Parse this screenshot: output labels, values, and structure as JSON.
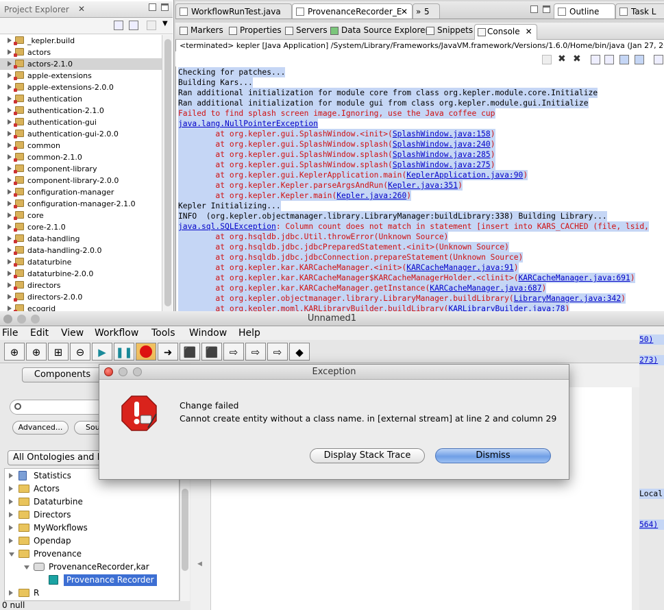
{
  "project_explorer": {
    "title": "Project Explorer",
    "items": [
      "_kepler.build",
      "actors",
      "actors-2.1.0",
      "apple-extensions",
      "apple-extensions-2.0.0",
      "authentication",
      "authentication-2.1.0",
      "authentication-gui",
      "authentication-gui-2.0.0",
      "common",
      "common-2.1.0",
      "component-library",
      "component-library-2.0.0",
      "configuration-manager",
      "configuration-manager-2.1.0",
      "core",
      "core-2.1.0",
      "data-handling",
      "data-handling-2.0.0",
      "dataturbine",
      "dataturbine-2.0.0",
      "directors",
      "directors-2.0.0",
      "ecogrid"
    ],
    "selected_index": 2
  },
  "editor_tabs": [
    "WorkflowRunTest.java",
    "ProvenanceRecorder_E",
    "5"
  ],
  "outline_tabs": [
    "Outline",
    "Task L"
  ],
  "console_tabs": [
    "Markers",
    "Properties",
    "Servers",
    "Data Source Explorer",
    "Snippets",
    "Console"
  ],
  "console_status": "<terminated> kepler [Java Application] /System/Library/Frameworks/JavaVM.framework/Versions/1.6.0/Home/bin/java (Jan 27, 20",
  "console_lines": [
    {
      "text": "Checking for patches...",
      "kind": "normal"
    },
    {
      "text": "Building Kars...",
      "kind": "normal"
    },
    {
      "text": "Ran additional initialization for module core from class org.kepler.module.core.Initialize",
      "kind": "normal"
    },
    {
      "text": "Ran additional initialization for module gui from class org.kepler.module.gui.Initialize",
      "kind": "normal"
    },
    {
      "text": "Failed to find splash screen image.Ignoring, use the Java coffee cup",
      "kind": "err"
    },
    {
      "pre": "",
      "link": "java.lang.NullPointerException",
      "post": "",
      "kind": "normal"
    },
    {
      "pre": "        at org.kepler.gui.SplashWindow.<init>(",
      "link": "SplashWindow.java:158",
      "post": ")",
      "kind": "err"
    },
    {
      "pre": "        at org.kepler.gui.SplashWindow.splash(",
      "link": "SplashWindow.java:240",
      "post": ")",
      "kind": "err"
    },
    {
      "pre": "        at org.kepler.gui.SplashWindow.splash(",
      "link": "SplashWindow.java:285",
      "post": ")",
      "kind": "err"
    },
    {
      "pre": "        at org.kepler.gui.SplashWindow.splash(",
      "link": "SplashWindow.java:275",
      "post": ")",
      "kind": "err"
    },
    {
      "pre": "        at org.kepler.gui.KeplerApplication.main(",
      "link": "KeplerApplication.java:90",
      "post": ")",
      "kind": "err"
    },
    {
      "pre": "        at org.kepler.Kepler.parseArgsAndRun(",
      "link": "Kepler.java:351",
      "post": ")",
      "kind": "err"
    },
    {
      "pre": "        at org.kepler.Kepler.main(",
      "link": "Kepler.java:260",
      "post": ")",
      "kind": "err"
    },
    {
      "text": "Kepler Initializing...",
      "kind": "normal"
    },
    {
      "text": "INFO  (org.kepler.objectmanager.library.LibraryManager:buildLibrary:338) Building Library...",
      "kind": "normal"
    },
    {
      "pre": "",
      "link": "java.sql.SQLException",
      "post": ": Column count does not match in statement [insert into KARS_CACHED (file, lsid,",
      "kind": "mixed"
    },
    {
      "text": "        at org.hsqldb.jdbc.Util.throwError(Unknown Source)",
      "kind": "err"
    },
    {
      "text": "        at org.hsqldb.jdbc.jdbcPreparedStatement.<init>(Unknown Source)",
      "kind": "err"
    },
    {
      "text": "        at org.hsqldb.jdbc.jdbcConnection.prepareStatement(Unknown Source)",
      "kind": "err"
    },
    {
      "pre": "        at org.kepler.kar.KARCacheManager.<init>(",
      "link": "KARCacheManager.java:91",
      "post": ")",
      "kind": "err"
    },
    {
      "pre": "        at org.kepler.kar.KARCacheManager$KARCacheManagerHolder.<clinit>(",
      "link": "KARCacheManager.java:691",
      "post": ")",
      "kind": "err"
    },
    {
      "pre": "        at org.kepler.kar.KARCacheManager.getInstance(",
      "link": "KARCacheManager.java:687",
      "post": ")",
      "kind": "err"
    },
    {
      "pre": "        at org.kepler.objectmanager.library.LibraryManager.buildLibrary(",
      "link": "LibraryManager.java:342",
      "post": ")",
      "kind": "err"
    },
    {
      "pre": "        at org.kepler.moml.KARLibraryBuilder.buildLibrary(",
      "link": "KARLibraryBuilder.java:78",
      "post": ")",
      "kind": "err"
    }
  ],
  "console_tail": [
    "50)",
    "",
    "273)",
    "",
    "",
    "",
    "",
    "",
    "",
    "",
    "",
    "",
    "",
    "",
    "",
    "Local",
    "",
    "",
    "564)"
  ],
  "kepler": {
    "window_title": "Unnamed1",
    "menu": [
      "File",
      "Edit",
      "View",
      "Workflow",
      "Tools",
      "Window",
      "Help"
    ],
    "components_tab": "Components",
    "advanced_button": "Advanced...",
    "sources_button": "Sou",
    "ontology_select": "All Ontologies and F",
    "library": [
      {
        "label": "Statistics",
        "level": 0,
        "expanded": false,
        "icon": "doc"
      },
      {
        "label": "Actors",
        "level": 0,
        "expanded": false,
        "icon": "folder"
      },
      {
        "label": "Dataturbine",
        "level": 0,
        "expanded": false,
        "icon": "folder"
      },
      {
        "label": "Directors",
        "level": 0,
        "expanded": false,
        "icon": "folder"
      },
      {
        "label": "MyWorkflows",
        "level": 0,
        "expanded": false,
        "icon": "folder"
      },
      {
        "label": "Opendap",
        "level": 0,
        "expanded": false,
        "icon": "folder"
      },
      {
        "label": "Provenance",
        "level": 0,
        "expanded": true,
        "icon": "folder"
      },
      {
        "label": "ProvenanceRecorder,kar",
        "level": 1,
        "expanded": true,
        "icon": "kar"
      },
      {
        "label": "Provenance Recorder",
        "level": 2,
        "expanded": false,
        "icon": "actor",
        "selected": true
      },
      {
        "label": "R",
        "level": 0,
        "expanded": false,
        "icon": "folder"
      }
    ],
    "status": "0 null"
  },
  "dialog": {
    "title": "Exception",
    "heading": "Change failed",
    "message": "Cannot create entity without a class name. in [external stream] at line 2 and column 29",
    "trace_button": "Display Stack Trace",
    "dismiss_button": "Dismiss"
  }
}
